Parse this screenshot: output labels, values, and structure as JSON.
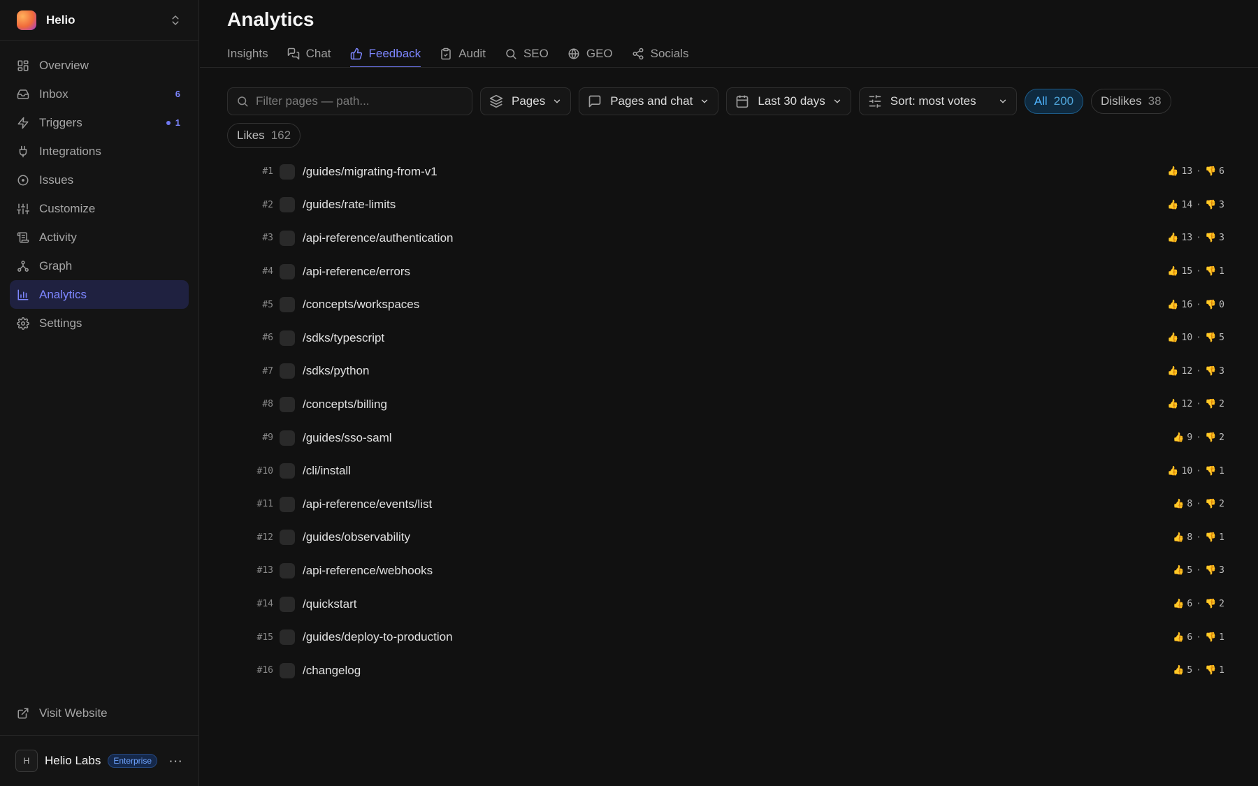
{
  "workspace": {
    "name": "Helio"
  },
  "sidebar": {
    "items": [
      {
        "label": "Overview",
        "icon": "grid-icon",
        "badge": ""
      },
      {
        "label": "Inbox",
        "icon": "inbox-icon",
        "badge": "6"
      },
      {
        "label": "Triggers",
        "icon": "bolt-icon",
        "badge": "1"
      },
      {
        "label": "Integrations",
        "icon": "plug-icon",
        "badge": ""
      },
      {
        "label": "Issues",
        "icon": "circle-dot-icon",
        "badge": ""
      },
      {
        "label": "Customize",
        "icon": "sliders-icon",
        "badge": ""
      },
      {
        "label": "Activity",
        "icon": "scroll-icon",
        "badge": ""
      },
      {
        "label": "Graph",
        "icon": "graph-icon",
        "badge": ""
      },
      {
        "label": "Analytics",
        "icon": "bar-chart-icon",
        "badge": ""
      },
      {
        "label": "Settings",
        "icon": "gear-icon",
        "badge": ""
      }
    ],
    "active": "Analytics",
    "visit_website": "Visit Website"
  },
  "user": {
    "initial": "H",
    "name": "Helio Labs",
    "plan": "Enterprise"
  },
  "page": {
    "title": "Analytics"
  },
  "tabs": [
    {
      "label": "Insights"
    },
    {
      "label": "Chat"
    },
    {
      "label": "Feedback"
    },
    {
      "label": "Audit"
    },
    {
      "label": "SEO"
    },
    {
      "label": "GEO"
    },
    {
      "label": "Socials"
    }
  ],
  "active_tab": "Feedback",
  "filters": {
    "search_placeholder": "Filter pages — path...",
    "content_type": "Pages",
    "source": "Pages and chat",
    "range": "Last 30 days",
    "sort": "Sort: most votes",
    "pills": [
      {
        "label": "All",
        "count": "200",
        "active": true
      },
      {
        "label": "Dislikes",
        "count": "38",
        "active": false
      },
      {
        "label": "Likes",
        "count": "162",
        "active": false
      }
    ]
  },
  "rows": [
    {
      "rank": "#1",
      "path": "/guides/migrating-from-v1",
      "likes": "13",
      "dislikes": "6"
    },
    {
      "rank": "#2",
      "path": "/guides/rate-limits",
      "likes": "14",
      "dislikes": "3"
    },
    {
      "rank": "#3",
      "path": "/api-reference/authentication",
      "likes": "13",
      "dislikes": "3"
    },
    {
      "rank": "#4",
      "path": "/api-reference/errors",
      "likes": "15",
      "dislikes": "1"
    },
    {
      "rank": "#5",
      "path": "/concepts/workspaces",
      "likes": "16",
      "dislikes": "0"
    },
    {
      "rank": "#6",
      "path": "/sdks/typescript",
      "likes": "10",
      "dislikes": "5"
    },
    {
      "rank": "#7",
      "path": "/sdks/python",
      "likes": "12",
      "dislikes": "3"
    },
    {
      "rank": "#8",
      "path": "/concepts/billing",
      "likes": "12",
      "dislikes": "2"
    },
    {
      "rank": "#9",
      "path": "/guides/sso-saml",
      "likes": "9",
      "dislikes": "2"
    },
    {
      "rank": "#10",
      "path": "/cli/install",
      "likes": "10",
      "dislikes": "1"
    },
    {
      "rank": "#11",
      "path": "/api-reference/events/list",
      "likes": "8",
      "dislikes": "2"
    },
    {
      "rank": "#12",
      "path": "/guides/observability",
      "likes": "8",
      "dislikes": "1"
    },
    {
      "rank": "#13",
      "path": "/api-reference/webhooks",
      "likes": "5",
      "dislikes": "3"
    },
    {
      "rank": "#14",
      "path": "/quickstart",
      "likes": "6",
      "dislikes": "2"
    },
    {
      "rank": "#15",
      "path": "/guides/deploy-to-production",
      "likes": "6",
      "dislikes": "1"
    },
    {
      "rank": "#16",
      "path": "/changelog",
      "likes": "5",
      "dislikes": "1"
    }
  ],
  "vote_separator": "·",
  "icons": {
    "like": "👍",
    "dislike": "👎"
  },
  "colors": {
    "accent": "#7d86ff",
    "all_pill": "#4fb4ff"
  }
}
